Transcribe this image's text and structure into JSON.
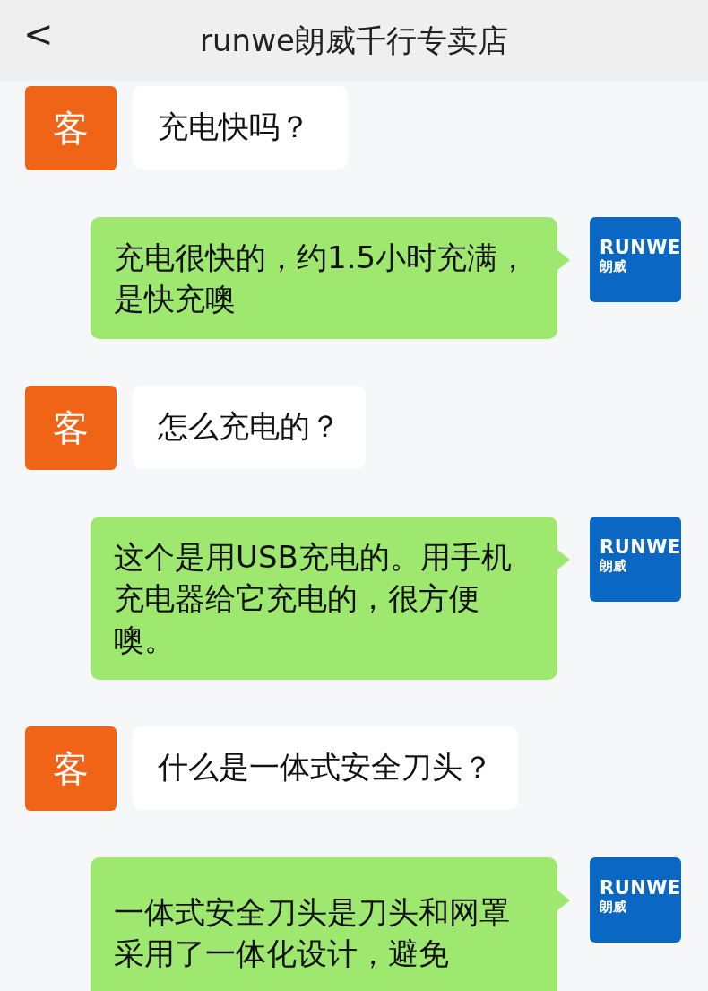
{
  "header": {
    "back": "<",
    "title": "runwe朗威千行专卖店"
  },
  "messages": [
    {
      "kind": "customer",
      "avatar": "客",
      "text": "充电快吗？"
    },
    {
      "kind": "store",
      "avatar": [
        "RUNWE",
        "朗威"
      ],
      "text": "充电很快的，约1.5小时充满，是快充噢"
    },
    {
      "kind": "customer",
      "avatar": "客",
      "text": "怎么充电的？"
    },
    {
      "kind": "store",
      "avatar": [
        "RUNWE",
        "朗威"
      ],
      "text": "这个是用USB充电的。用手机充电器给它充电的，很方便噢。"
    },
    {
      "kind": "customer",
      "avatar": "客",
      "text": "什么是一体式安全刀头？"
    },
    {
      "kind": "store",
      "avatar": [
        "RUNWE",
        "朗威"
      ],
      "text": "一体式安全刀头是刀头和网罩采用了一体化设计，避免"
    }
  ]
}
